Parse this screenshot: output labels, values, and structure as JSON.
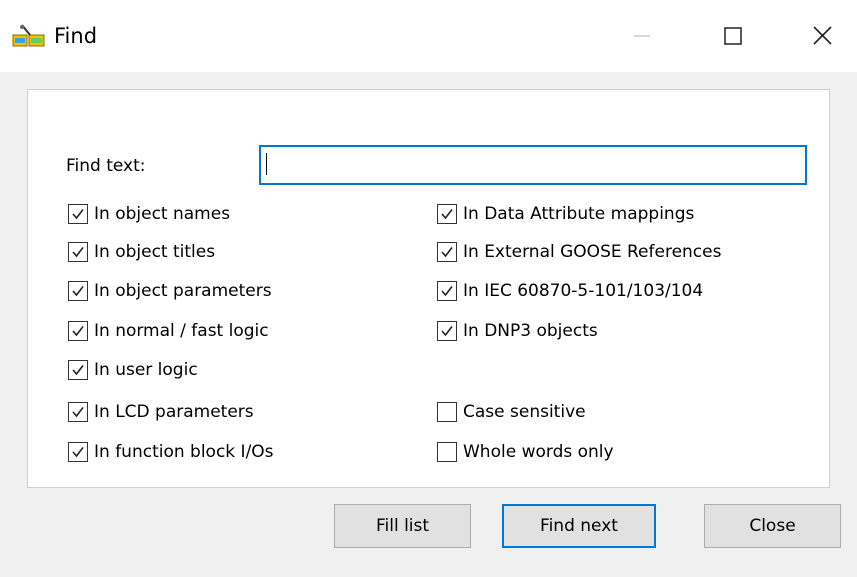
{
  "window": {
    "title": "Find",
    "icon": "find-app-icon",
    "controls": {
      "minimize_icon": "minimize-icon",
      "maximize_icon": "maximize-icon",
      "close_icon": "close-icon"
    }
  },
  "find": {
    "label": "Find text:",
    "value": "",
    "placeholder": ""
  },
  "options_left": [
    {
      "label": "In object names",
      "checked": true
    },
    {
      "label": "In object titles",
      "checked": true
    },
    {
      "label": "In object parameters",
      "checked": true
    },
    {
      "label": "In normal / fast logic",
      "checked": true
    },
    {
      "label": "In user logic",
      "checked": true
    },
    {
      "label": "In LCD parameters",
      "checked": true
    },
    {
      "label": "In function block I/Os",
      "checked": true
    }
  ],
  "options_right": [
    {
      "label": "In Data Attribute mappings",
      "checked": true
    },
    {
      "label": "In External GOOSE References",
      "checked": true
    },
    {
      "label": "In IEC 60870-5-101/103/104",
      "checked": true
    },
    {
      "label": "In DNP3 objects",
      "checked": true
    },
    {
      "label": "Case sensitive",
      "checked": false
    },
    {
      "label": "Whole words only",
      "checked": false
    }
  ],
  "buttons": {
    "fill_list": "Fill list",
    "find_next": "Find next",
    "close": "Close"
  },
  "colors": {
    "accent": "#0078d7",
    "dialog_bg": "#f0f0f0",
    "button_bg": "#e1e1e1"
  }
}
